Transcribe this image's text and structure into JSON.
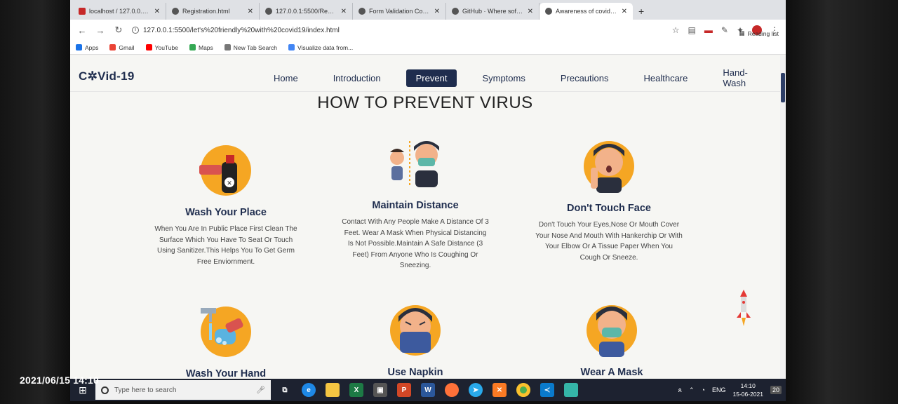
{
  "tabs": [
    {
      "label": "localhost / 127.0.0.1 / ...",
      "icon": "red"
    },
    {
      "label": "Registration.html",
      "icon": "globe"
    },
    {
      "label": "127.0.0.1:5500/Registr...",
      "icon": "globe"
    },
    {
      "label": "Form Validation Contr...",
      "icon": "globe"
    },
    {
      "label": "GitHub · Where softwa...",
      "icon": "github"
    },
    {
      "label": "Awareness of covid-19...",
      "icon": "globe",
      "active": true
    }
  ],
  "address": {
    "url": "127.0.0.1:5500/let's%20friendly%20with%20covid19/index.html"
  },
  "bookmarks": [
    {
      "label": "Apps",
      "color": "#1a73e8"
    },
    {
      "label": "Gmail",
      "color": "#ea4335"
    },
    {
      "label": "YouTube",
      "color": "#ff0000"
    },
    {
      "label": "Maps",
      "color": "#34a853"
    },
    {
      "label": "New Tab Search",
      "color": "#777"
    },
    {
      "label": "Visualize data from...",
      "color": "#4285f4"
    }
  ],
  "reading_list": "Reading list",
  "site": {
    "logo": "C✲Vid-19",
    "menu": [
      {
        "label": "Home"
      },
      {
        "label": "Introduction"
      },
      {
        "label": "Prevent",
        "active": true
      },
      {
        "label": "Symptoms"
      },
      {
        "label": "Precautions"
      },
      {
        "label": "Healthcare"
      },
      {
        "label": "Hand-Wash"
      }
    ],
    "title": "HOW TO PREVENT VIRUS",
    "cards": [
      {
        "icon": "spray-bottle-icon",
        "title": "Wash Your Place",
        "text": "When You Are In Public Place First Clean The Surface Which You Have To Seat Or Touch Using Sanitizer.This Helps You To Get Germ Free Enviornment."
      },
      {
        "icon": "social-distance-icon",
        "title": "Maintain Distance",
        "text": "Contact With Any People Make A Distance Of 3 Feet. Wear A Mask When Physical Distancing Is Not Possible.Maintain A Safe Distance (3 Feet) From Anyone Who Is Coughing Or Sneezing."
      },
      {
        "icon": "face-touch-icon",
        "title": "Don't Touch Face",
        "text": "Don't Touch Your Eyes,Nose Or Mouth Cover Your Nose And Mouth With Hankerchip Or With Your Elbow Or A Tissue Paper When You Cough Or Sneeze."
      },
      {
        "icon": "hand-wash-icon",
        "title": "Wash Your Hand",
        "text": ""
      },
      {
        "icon": "napkin-icon",
        "title": "Use Napkin",
        "text": ""
      },
      {
        "icon": "mask-icon",
        "title": "Wear A Mask",
        "text": ""
      }
    ]
  },
  "taskbar": {
    "search_placeholder": "Type here to search",
    "lang": "ENG",
    "time": "14:10",
    "date": "15-06-2021",
    "notifications": "20"
  },
  "photo_timestamp": "2021/06/15 14:10"
}
